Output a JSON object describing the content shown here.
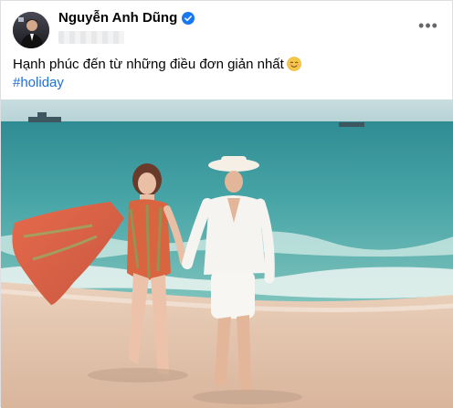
{
  "post": {
    "author_name": "Nguyễn Anh Dũng",
    "verified": true,
    "caption": "Hạnh phúc đến từ những điều đơn giản nhất",
    "caption_emoji": "smiling-face-emoji",
    "hashtag": "#holiday",
    "more_label": "•••"
  },
  "photo": {
    "scene": "beach-couple-photo"
  },
  "colors": {
    "link": "#216fdb",
    "verified_badge": "#1877f2",
    "text": "#050505",
    "muted": "#65676b"
  }
}
